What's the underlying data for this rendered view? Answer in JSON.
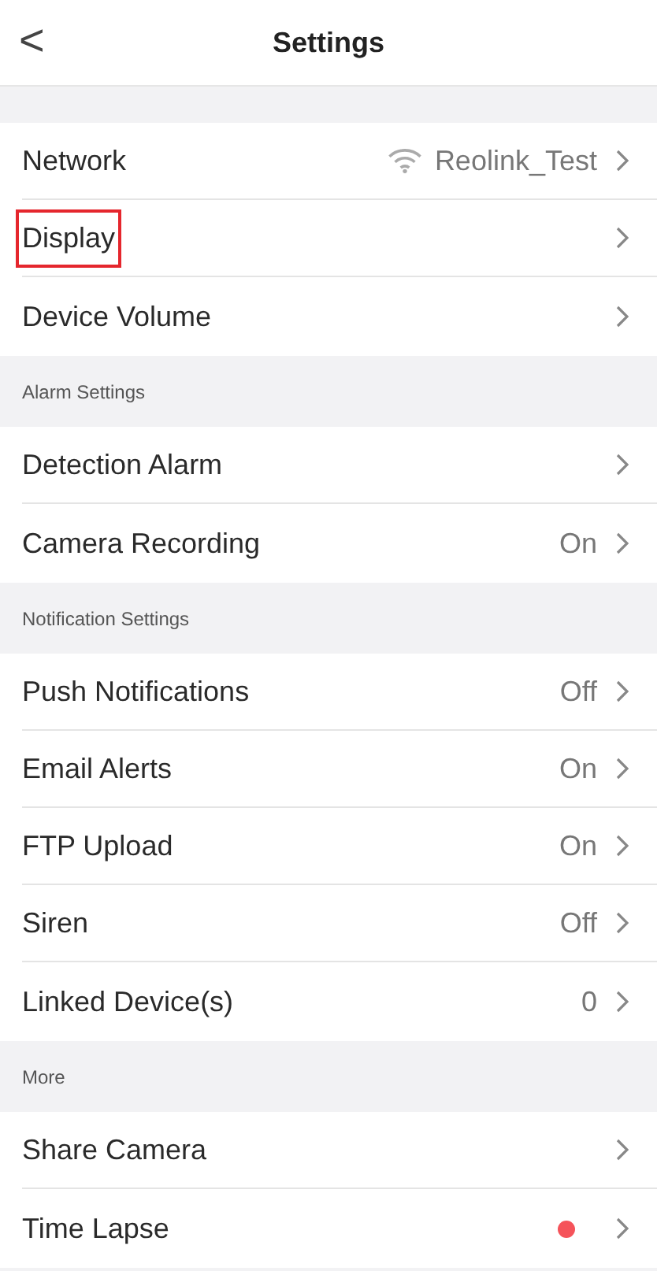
{
  "header": {
    "back": "<",
    "title": "Settings"
  },
  "sections": [
    {
      "rows": [
        {
          "label": "Network",
          "kind": "network",
          "value": "Reolink_Test",
          "highlighted": false
        },
        {
          "label": "Display",
          "kind": "plain",
          "highlighted": true
        },
        {
          "label": "Device Volume",
          "kind": "plain",
          "highlighted": false
        }
      ]
    },
    {
      "title": "Alarm Settings",
      "rows": [
        {
          "label": "Detection Alarm",
          "kind": "plain",
          "highlighted": false
        },
        {
          "label": "Camera Recording",
          "kind": "text",
          "value": "On",
          "highlighted": false
        }
      ]
    },
    {
      "title": "Notification Settings",
      "rows": [
        {
          "label": "Push Notifications",
          "kind": "text",
          "value": "Off",
          "highlighted": false
        },
        {
          "label": "Email Alerts",
          "kind": "text",
          "value": "On",
          "highlighted": false
        },
        {
          "label": "FTP Upload",
          "kind": "text",
          "value": "On",
          "highlighted": false
        },
        {
          "label": "Siren",
          "kind": "text",
          "value": "Off",
          "highlighted": false
        },
        {
          "label": "Linked Device(s)",
          "kind": "text",
          "value": "0",
          "highlighted": false
        }
      ]
    },
    {
      "title": "More",
      "rows": [
        {
          "label": "Share Camera",
          "kind": "plain",
          "highlighted": false
        },
        {
          "label": "Time Lapse",
          "kind": "dot",
          "color": "#f5535a",
          "highlighted": false
        }
      ]
    }
  ]
}
